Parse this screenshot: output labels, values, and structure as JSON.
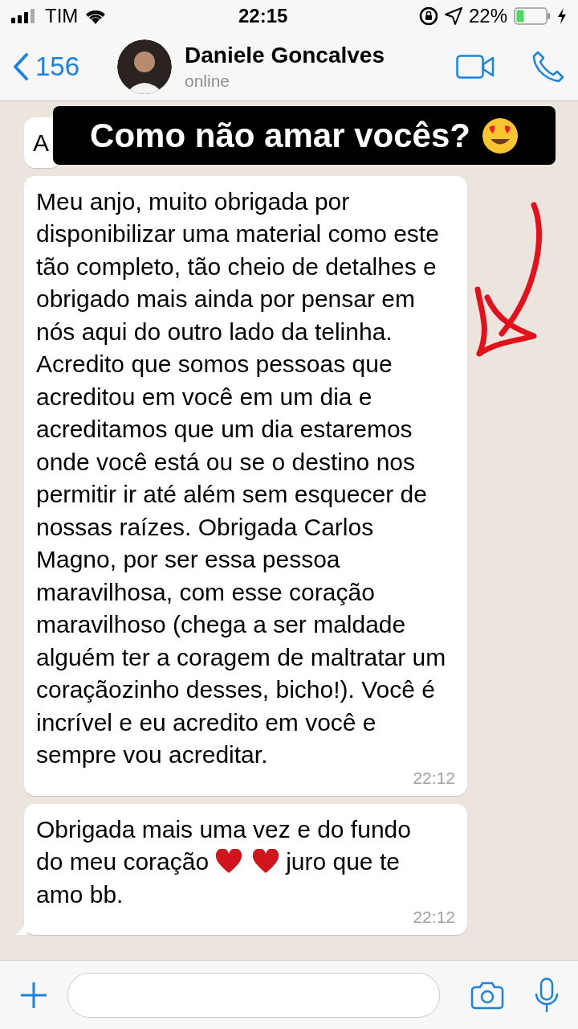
{
  "status_bar": {
    "carrier": "TIM",
    "time": "22:15",
    "battery": "22%"
  },
  "header": {
    "back_count": "156",
    "contact_name": "Daniele Goncalves",
    "presence": "online"
  },
  "messages": [
    {
      "segments": [
        {
          "kind": "text",
          "text": "A"
        }
      ]
    },
    {
      "segments": [
        {
          "kind": "text",
          "text": "Meu anjo, muito obrigada por disponibilizar uma material como este tão completo, tão cheio de detalhes e obrigado mais ainda por pensar em nós aqui do outro lado da telinha. Acredito que somos pessoas que acreditou em você em um dia e acreditamos que um dia estaremos onde você está ou se o destino nos permitir ir até além sem esquecer de nossas raízes. Obrigada Carlos Magno, por ser essa pessoa maravilhosa, com esse coração maravilhoso (chega a ser maldade alguém ter a coragem de maltratar um coraçãozinho desses, bicho!). Você é incrível e eu acredito em você e sempre vou acreditar."
        }
      ],
      "time": "22:12"
    },
    {
      "lines": [
        [
          {
            "kind": "text",
            "text": "Obrigada mais uma vez e do fundo"
          }
        ],
        [
          {
            "kind": "text",
            "text": "do meu coração"
          },
          {
            "kind": "heart"
          },
          {
            "kind": "heart"
          },
          {
            "kind": "text",
            "text": "juro que te"
          }
        ],
        [
          {
            "kind": "text",
            "text": "amo bb."
          }
        ]
      ],
      "time": "22:12",
      "tail": true
    }
  ],
  "caption": {
    "text": "Como não amar vocês?"
  }
}
